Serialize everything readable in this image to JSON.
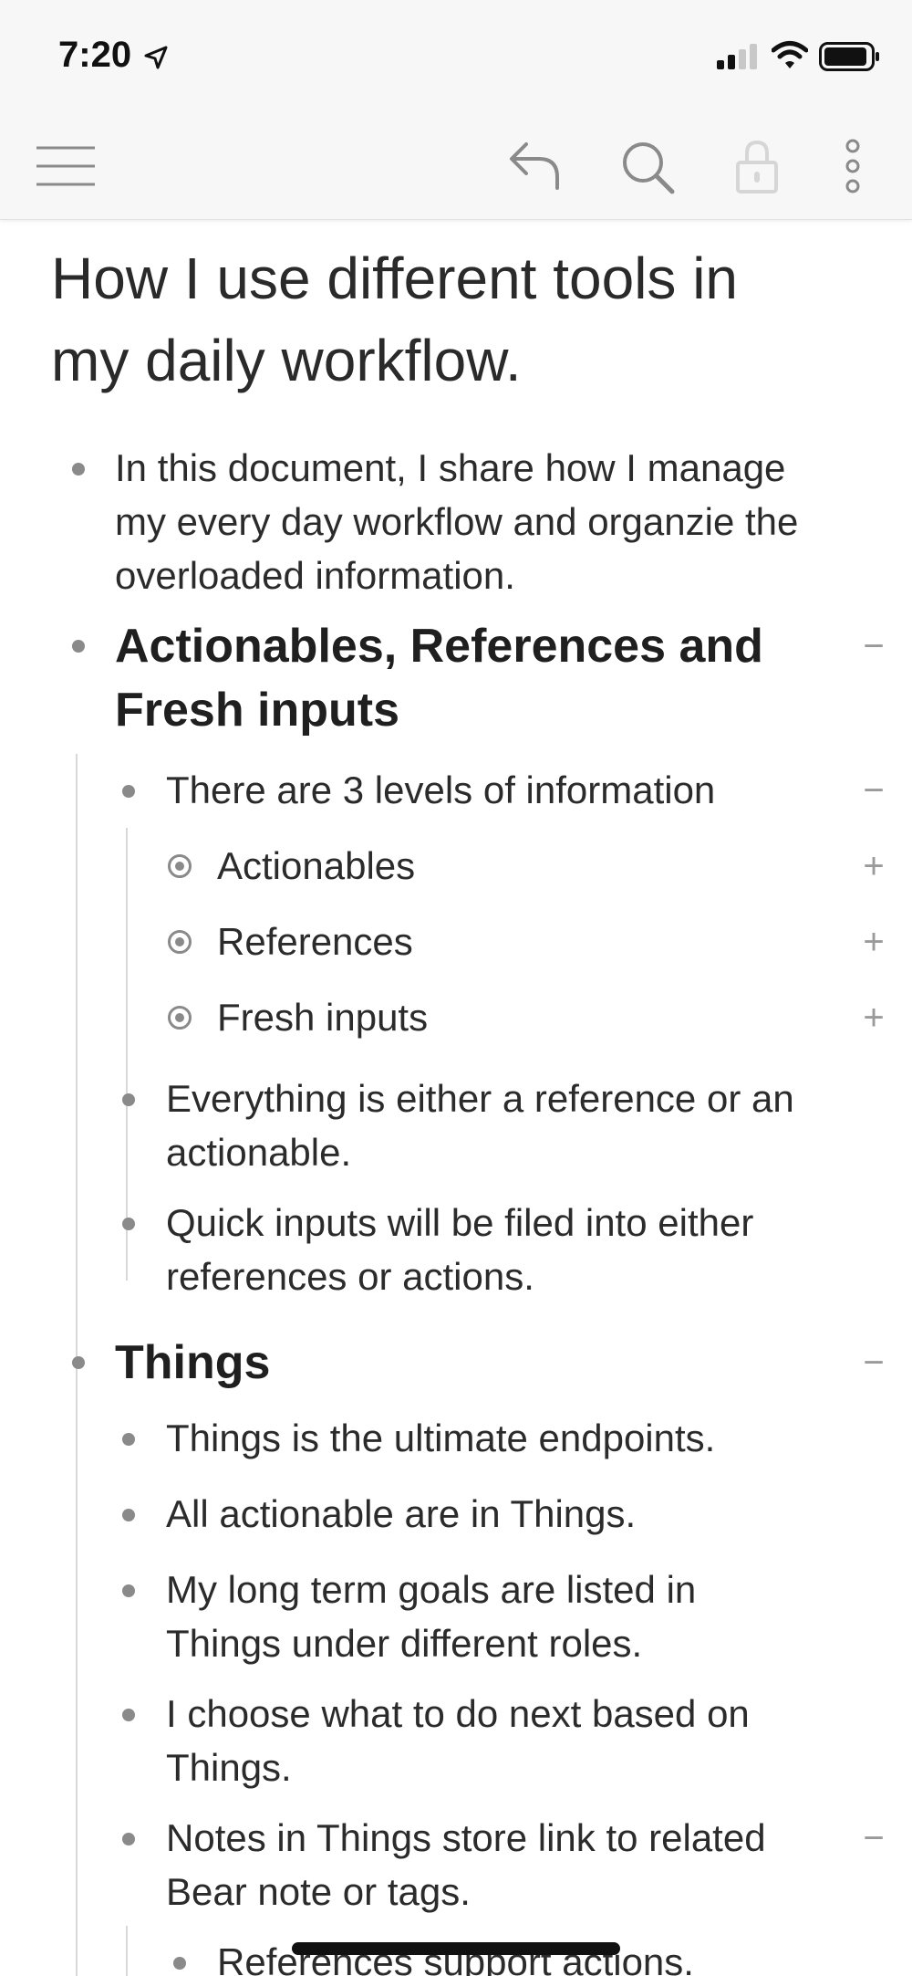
{
  "status": {
    "time": "7:20"
  },
  "colors": {
    "bullet": "#8a8a8a",
    "text": "#2b2b2b",
    "toolbar": "#f7f7f7"
  },
  "icons": {
    "menu": "hamburger-icon",
    "undo": "undo-icon",
    "search": "search-icon",
    "lock": "lock-icon",
    "more": "more-vertical-icon"
  },
  "document": {
    "title": "How I use different tools in my daily workflow.",
    "items": {
      "intro": "In this document, I share how I manage my every day workflow and organzie the overloaded information.",
      "section1": {
        "heading": "Actionables, References and Fresh inputs",
        "levels": "There are 3 levels of information",
        "level_items": [
          "Actionables",
          "References",
          "Fresh inputs"
        ],
        "either": "Everything is either a reference or an actionable.",
        "quick": "Quick inputs will be filed into either references or actions."
      },
      "section2": {
        "heading": "Things",
        "endpoints": "Things is the ultimate endpoints.",
        "all_actionable": "All actionable are in Things.",
        "goals": "My long term goals are listed in Things under different roles.",
        "choose": "I choose what to do next based on Things.",
        "notes": "Notes in Things store link to related Bear note or tags.",
        "support": "References support actions."
      }
    },
    "toggles": {
      "collapse": "−",
      "expand": "+"
    }
  }
}
